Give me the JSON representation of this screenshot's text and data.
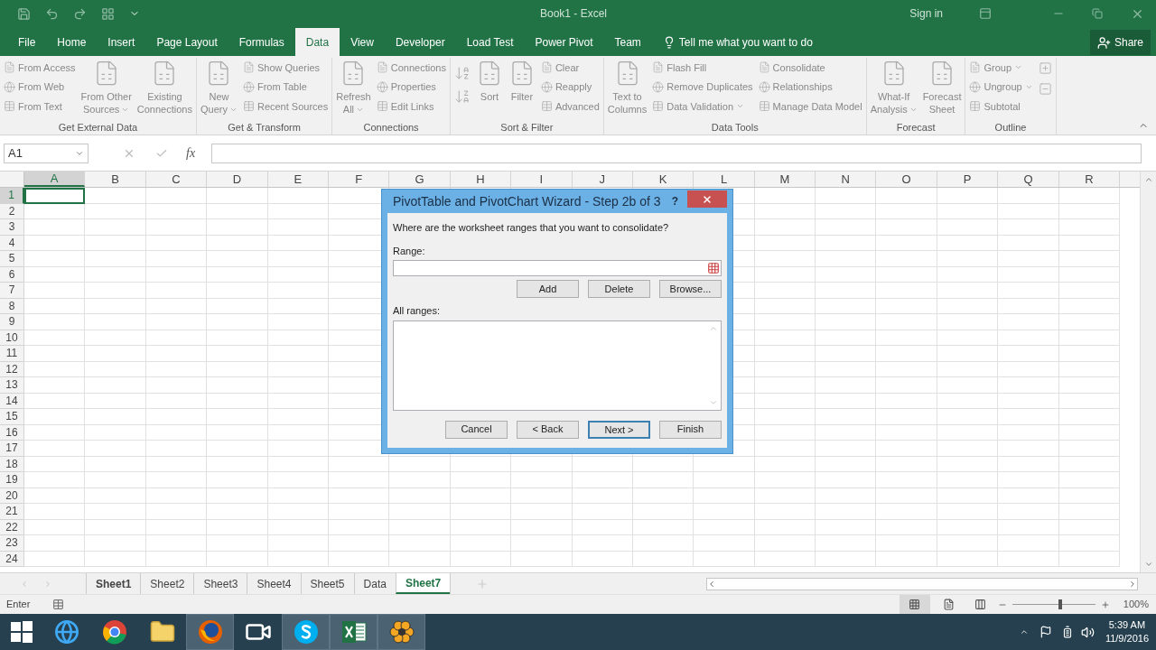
{
  "title_bar": {
    "title": "Book1 - Excel",
    "sign_in": "Sign in"
  },
  "ribbon_tabs": [
    {
      "label": "File",
      "selected": false
    },
    {
      "label": "Home",
      "selected": false
    },
    {
      "label": "Insert",
      "selected": false
    },
    {
      "label": "Page Layout",
      "selected": false
    },
    {
      "label": "Formulas",
      "selected": false
    },
    {
      "label": "Data",
      "selected": true
    },
    {
      "label": "View",
      "selected": false
    },
    {
      "label": "Developer",
      "selected": false
    },
    {
      "label": "Load Test",
      "selected": false
    },
    {
      "label": "Power Pivot",
      "selected": false
    },
    {
      "label": "Team",
      "selected": false
    }
  ],
  "tell_me": "Tell me what you want to do",
  "share": "Share",
  "ribbon_groups": [
    {
      "label": "Get External Data",
      "columns": [
        {
          "kind": "stack",
          "entries": [
            {
              "label": "From Access",
              "dropdown": false
            },
            {
              "label": "From Web",
              "dropdown": false
            },
            {
              "label": "From Text",
              "dropdown": false
            }
          ]
        },
        {
          "kind": "large",
          "lines": [
            "From Other",
            "Sources"
          ],
          "dropdown": true
        },
        {
          "kind": "large",
          "lines": [
            "Existing",
            "Connections"
          ],
          "dropdown": false
        }
      ]
    },
    {
      "label": "Get & Transform",
      "columns": [
        {
          "kind": "large",
          "lines": [
            "New",
            "Query"
          ],
          "dropdown": true
        },
        {
          "kind": "stack",
          "entries": [
            {
              "label": "Show Queries",
              "dropdown": false
            },
            {
              "label": "From Table",
              "dropdown": false
            },
            {
              "label": "Recent Sources",
              "dropdown": false
            }
          ]
        }
      ]
    },
    {
      "label": "Connections",
      "columns": [
        {
          "kind": "large",
          "lines": [
            "Refresh",
            "All"
          ],
          "dropdown": true
        },
        {
          "kind": "stack",
          "entries": [
            {
              "label": "Connections",
              "dropdown": false
            },
            {
              "label": "Properties",
              "dropdown": false
            },
            {
              "label": "Edit Links",
              "dropdown": false
            }
          ]
        }
      ]
    },
    {
      "label": "Sort & Filter",
      "columns": [
        {
          "kind": "sort_icons"
        },
        {
          "kind": "large",
          "lines": [
            "Sort"
          ],
          "dropdown": false
        },
        {
          "kind": "large",
          "lines": [
            "Filter"
          ],
          "dropdown": false
        },
        {
          "kind": "stack",
          "entries": [
            {
              "label": "Clear",
              "dropdown": false
            },
            {
              "label": "Reapply",
              "dropdown": false
            },
            {
              "label": "Advanced",
              "dropdown": false
            }
          ]
        }
      ]
    },
    {
      "label": "Data Tools",
      "columns": [
        {
          "kind": "large",
          "lines": [
            "Text to",
            "Columns"
          ],
          "dropdown": false
        },
        {
          "kind": "stack",
          "entries": [
            {
              "label": "Flash Fill",
              "dropdown": false
            },
            {
              "label": "Remove Duplicates",
              "dropdown": false
            },
            {
              "label": "Data Validation",
              "dropdown": true
            }
          ]
        },
        {
          "kind": "stack",
          "entries": [
            {
              "label": "Consolidate",
              "dropdown": false
            },
            {
              "label": "Relationships",
              "dropdown": false
            },
            {
              "label": "Manage Data Model",
              "dropdown": false
            }
          ]
        }
      ]
    },
    {
      "label": "Forecast",
      "columns": [
        {
          "kind": "large",
          "lines": [
            "What-If",
            "Analysis"
          ],
          "dropdown": true
        },
        {
          "kind": "large",
          "lines": [
            "Forecast",
            "Sheet"
          ],
          "dropdown": false
        }
      ]
    },
    {
      "label": "Outline",
      "columns": [
        {
          "kind": "stack",
          "entries": [
            {
              "label": "Group",
              "dropdown": true
            },
            {
              "label": "Ungroup",
              "dropdown": true
            },
            {
              "label": "Subtotal",
              "dropdown": false
            }
          ]
        },
        {
          "kind": "outline_icons"
        }
      ]
    }
  ],
  "name_box": "A1",
  "fx": "fx",
  "columns": [
    {
      "label": "A",
      "selected": true
    },
    {
      "label": "B",
      "selected": false
    },
    {
      "label": "C",
      "selected": false
    },
    {
      "label": "D",
      "selected": false
    },
    {
      "label": "E",
      "selected": false
    },
    {
      "label": "F",
      "selected": false
    },
    {
      "label": "G",
      "selected": false
    },
    {
      "label": "H",
      "selected": false
    },
    {
      "label": "I",
      "selected": false
    },
    {
      "label": "J",
      "selected": false
    },
    {
      "label": "K",
      "selected": false
    },
    {
      "label": "L",
      "selected": false
    },
    {
      "label": "M",
      "selected": false
    },
    {
      "label": "N",
      "selected": false
    },
    {
      "label": "O",
      "selected": false
    },
    {
      "label": "P",
      "selected": false
    },
    {
      "label": "Q",
      "selected": false
    },
    {
      "label": "R",
      "selected": false
    }
  ],
  "rows": [
    {
      "label": "1",
      "selected": true
    },
    {
      "label": "2",
      "selected": false
    },
    {
      "label": "3",
      "selected": false
    },
    {
      "label": "4",
      "selected": false
    },
    {
      "label": "5",
      "selected": false
    },
    {
      "label": "6",
      "selected": false
    },
    {
      "label": "7",
      "selected": false
    },
    {
      "label": "8",
      "selected": false
    },
    {
      "label": "9",
      "selected": false
    },
    {
      "label": "10",
      "selected": false
    },
    {
      "label": "11",
      "selected": false
    },
    {
      "label": "12",
      "selected": false
    },
    {
      "label": "13",
      "selected": false
    },
    {
      "label": "14",
      "selected": false
    },
    {
      "label": "15",
      "selected": false
    },
    {
      "label": "16",
      "selected": false
    },
    {
      "label": "17",
      "selected": false
    },
    {
      "label": "18",
      "selected": false
    },
    {
      "label": "19",
      "selected": false
    },
    {
      "label": "20",
      "selected": false
    },
    {
      "label": "21",
      "selected": false
    },
    {
      "label": "22",
      "selected": false
    },
    {
      "label": "23",
      "selected": false
    },
    {
      "label": "24",
      "selected": false
    }
  ],
  "dialog": {
    "title": "PivotTable and PivotChart Wizard - Step 2b of 3",
    "help": "?",
    "prompt": "Where are the worksheet ranges that you want to consolidate?",
    "range_label": "Range:",
    "range_buttons": [
      {
        "label": "Add",
        "default": false
      },
      {
        "label": "Delete",
        "default": false
      },
      {
        "label": "Browse...",
        "default": false
      }
    ],
    "all_ranges_label": "All ranges:",
    "footer_buttons": [
      {
        "label": "Cancel",
        "default": false
      },
      {
        "label": "< Back",
        "default": false
      },
      {
        "label": "Next >",
        "default": true
      },
      {
        "label": "Finish",
        "default": false
      }
    ]
  },
  "sheet_tabs": [
    {
      "label": "Sheet1",
      "selected": false,
      "hovered": true
    },
    {
      "label": "Sheet2",
      "selected": false,
      "hovered": false
    },
    {
      "label": "Sheet3",
      "selected": false,
      "hovered": false
    },
    {
      "label": "Sheet4",
      "selected": false,
      "hovered": false
    },
    {
      "label": "Sheet5",
      "selected": false,
      "hovered": false
    },
    {
      "label": "Data",
      "selected": false,
      "hovered": false
    },
    {
      "label": "Sheet7",
      "selected": true,
      "hovered": false
    }
  ],
  "status_bar": {
    "mode": "Enter",
    "zoom": {
      "level": 0.58,
      "reading": "100%"
    }
  },
  "taskbar": {
    "apps": [
      {
        "kind": "ie",
        "running": false
      },
      {
        "kind": "chrome",
        "running": false
      },
      {
        "kind": "folder",
        "running": false
      },
      {
        "kind": "firefox",
        "running": true
      },
      {
        "kind": "video",
        "running": false
      },
      {
        "kind": "skype",
        "running": true
      },
      {
        "kind": "excel",
        "running": true
      },
      {
        "kind": "flower",
        "running": true
      }
    ],
    "time": "5:39 AM",
    "date": "11/9/2016"
  }
}
